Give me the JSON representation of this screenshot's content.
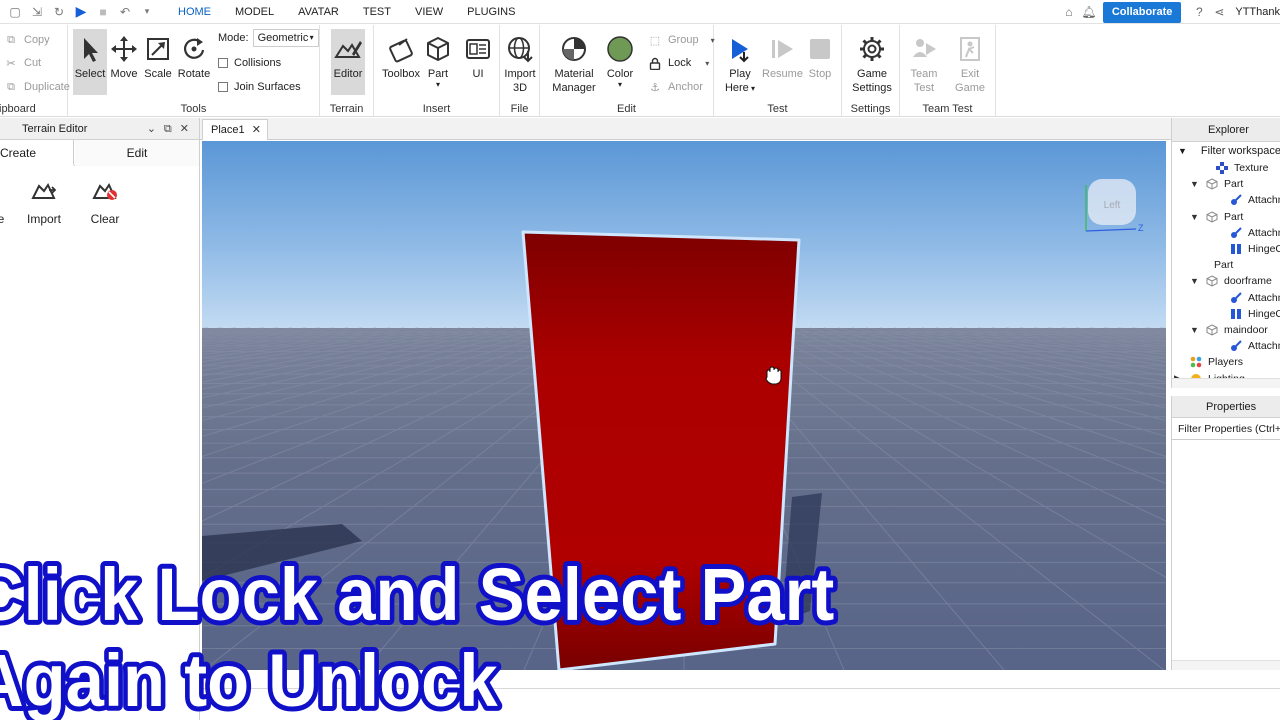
{
  "menu": {
    "tabs": [
      "HOME",
      "MODEL",
      "AVATAR",
      "TEST",
      "VIEW",
      "PLUGINS"
    ],
    "active_tab": "HOME",
    "collaborate": "Collaborate",
    "username": "YTThank"
  },
  "ribbon": {
    "clipboard": {
      "copy": "Copy",
      "cut": "Cut",
      "duplicate": "Duplicate",
      "label": "ipboard"
    },
    "tools": {
      "select": "Select",
      "move": "Move",
      "scale": "Scale",
      "rotate": "Rotate",
      "mode_label": "Mode:",
      "mode_value": "Geometric",
      "collisions": "Collisions",
      "join_surfaces": "Join Surfaces",
      "label": "Tools"
    },
    "terrain": {
      "editor": "Editor",
      "label": "Terrain"
    },
    "insert": {
      "toolbox": "Toolbox",
      "part": "Part",
      "ui": "UI",
      "label": "Insert"
    },
    "file": {
      "import3d_line1": "Import",
      "import3d_line2": "3D",
      "label": "File"
    },
    "edit": {
      "material_line1": "Material",
      "material_line2": "Manager",
      "color": "Color",
      "group": "Group",
      "lock": "Lock",
      "anchor": "Anchor",
      "label": "Edit"
    },
    "test": {
      "play_line1": "Play",
      "play_line2": "Here",
      "resume": "Resume",
      "stop": "Stop",
      "label": "Test"
    },
    "settings": {
      "game_line1": "Game",
      "game_line2": "Settings",
      "label": "Settings"
    },
    "team_test": {
      "team_line1": "Team",
      "team_line2": "Test",
      "exit_line1": "Exit",
      "exit_line2": "Game",
      "label": "Team Test"
    }
  },
  "doc_tab": {
    "title": "Place1"
  },
  "terrain_editor": {
    "title": "Terrain Editor",
    "tabs": {
      "create": "Create",
      "edit": "Edit"
    },
    "tools": [
      "e",
      "Import",
      "Clear"
    ]
  },
  "viewport": {
    "view_cube_label": "Left",
    "axis_z": "Z"
  },
  "explorer": {
    "title": "Explorer",
    "filter": "Filter workspace (",
    "items": [
      {
        "label": "Texture",
        "icon": "texture-icon"
      },
      {
        "label": "Part",
        "icon": "part-icon"
      },
      {
        "label": "Attachm",
        "icon": "attachment-icon"
      },
      {
        "label": "Part",
        "icon": "part-icon"
      },
      {
        "label": "Attachm",
        "icon": "attachment-icon"
      },
      {
        "label": "HingeC",
        "icon": "hinge-constraint-icon"
      },
      {
        "label": "Part",
        "icon": "none"
      },
      {
        "label": "doorframe",
        "icon": "part-icon"
      },
      {
        "label": "Attachm",
        "icon": "attachment-icon"
      },
      {
        "label": "HingeC",
        "icon": "hinge-constraint-icon"
      },
      {
        "label": "maindoor",
        "icon": "part-icon"
      },
      {
        "label": "Attachm",
        "icon": "attachment-icon"
      },
      {
        "label": "Players",
        "icon": "players-icon"
      },
      {
        "label": "Lighting",
        "icon": "lighting-icon"
      }
    ]
  },
  "properties": {
    "title": "Properties",
    "filter": "Filter Properties (Ctrl+S"
  },
  "caption": {
    "line1": "Click Lock and Select Part",
    "line2": "Again to Unlock"
  },
  "colors": {
    "accent": "#1a78d6",
    "door": "#b00000",
    "caption_fill": "#ffffff",
    "caption_stroke": "#1010c8"
  }
}
